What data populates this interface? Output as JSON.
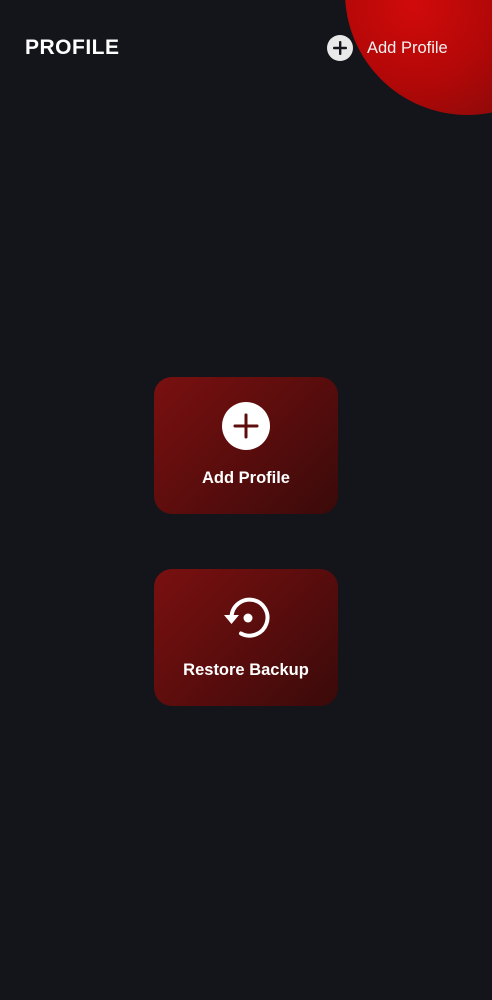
{
  "header": {
    "title": "PROFILE",
    "add_profile_label": "Add Profile",
    "add_icon": "plus-circle-icon"
  },
  "cards": {
    "add_profile": {
      "label": "Add Profile",
      "icon": "plus-circle-icon"
    },
    "restore_backup": {
      "label": "Restore Backup",
      "icon": "restore-icon"
    }
  },
  "colors": {
    "background": "#14151a",
    "accent": "#c40b0b",
    "card_start": "#7a1010",
    "card_end": "#3a0a0a",
    "text": "#ffffff"
  }
}
